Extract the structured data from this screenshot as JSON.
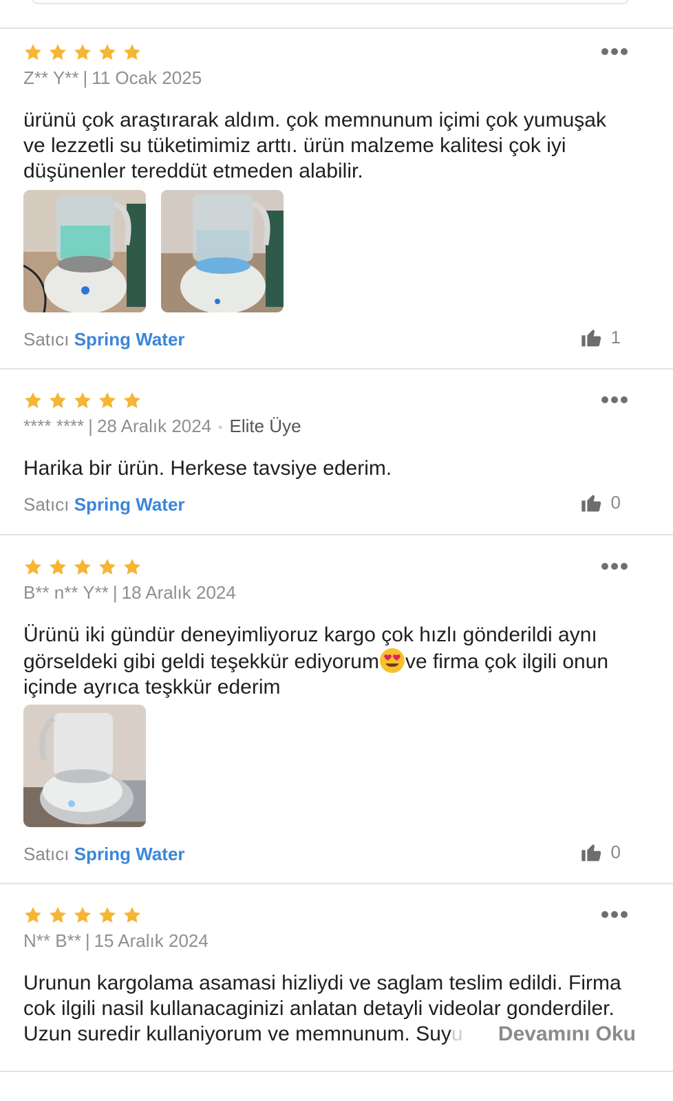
{
  "colors": {
    "star": "#f6b533",
    "accent": "#3b86d9",
    "muted": "#8a8a8a"
  },
  "reviews": [
    {
      "rating": 5,
      "author": "Z** Y**",
      "date": "11 Ocak 2025",
      "lines": [
        "ürünü çok araştırarak aldım. çok memnunum içimi çok yumuşak",
        "ve lezzetli su tüketimimiz arttı. ürün malzeme kalitesi çok iyi",
        "düşünenler tereddüt etmeden alabilir."
      ],
      "photos": [
        "product-photo-green-light",
        "product-photo-blue-light"
      ],
      "seller_label": "Satıcı",
      "seller_name": "Spring Water",
      "likes": "1"
    },
    {
      "rating": 5,
      "author": "**** ****",
      "date": "28 Aralık 2024",
      "badge": "Elite Üye",
      "lines": [
        "Harika bir ürün. Herkese tavsiye ederim."
      ],
      "seller_label": "Satıcı",
      "seller_name": "Spring Water",
      "likes": "0"
    },
    {
      "rating": 5,
      "author": "B** n** Y**",
      "date": "18 Aralık 2024",
      "line1": "Ürünü iki gündür deneyimliyoruz kargo çok hızlı gönderildi aynı",
      "line2_a": "görseldeki gibi geldi teşekkür ediyorum",
      "emoji": "heart-eyes-emoji",
      "line2_b": "ve firma çok ilgili onun",
      "line3": "içinde ayrıca teşkkür ederim",
      "photos": [
        "product-photo-side-view"
      ],
      "seller_label": "Satıcı",
      "seller_name": "Spring Water",
      "likes": "0"
    },
    {
      "rating": 5,
      "author": "N** B**",
      "date": "15 Aralık 2024",
      "line1": "Urunun kargolama asamasi hizliydi ve saglam teslim edildi. Firma",
      "line2": "cok ilgili nasil kullanacaginizi anlatan detayli videolar gonderdiler.",
      "line3_a": "Uzun suredir kullaniyorum ve memnunum. Suy",
      "line3_fade": "u",
      "read_more": "Devamını Oku"
    }
  ]
}
